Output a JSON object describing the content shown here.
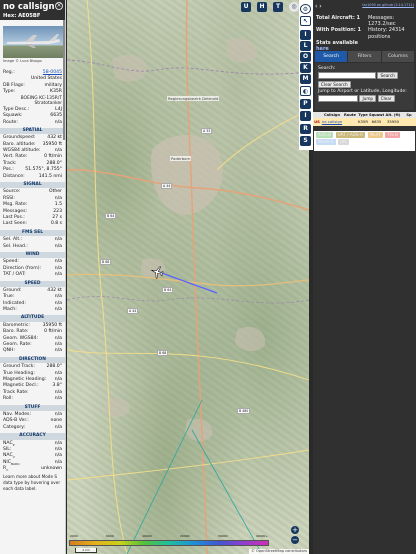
{
  "info": {
    "callsign": "no callsign",
    "hex": "Hex: AE05BF",
    "photo_credit": "Image © Luca Bisogo",
    "reg_label": "Reg.:",
    "reg_value": "58-0045",
    "country": "United States",
    "dbflags_label": "DB Flags:",
    "dbflags_value": "military",
    "type_label": "Type:",
    "type_value": "K35R",
    "type_desc": "BOEING KC-135R/T Stratotanker",
    "typedesc_label": "Type Desc.:",
    "typedesc_value": "L4J",
    "squawk_label": "Squawk:",
    "squawk_value": "6635",
    "route_label": "Route:",
    "route_value": "n/a",
    "sections": {
      "spatial": "SPATIAL",
      "signal": "SIGNAL",
      "fms": "FMS SEL",
      "wind": "WIND",
      "speed": "SPEED",
      "altitude": "ALTITUDE",
      "direction": "DIRECTION",
      "stuff": "STUFF",
      "accuracy": "ACCURACY"
    },
    "spatial": [
      {
        "k": "Groundspeed:",
        "v": "432 kt"
      },
      {
        "k": "Baro. altitude:",
        "v": "35950 ft"
      },
      {
        "k": "WGS84 altitude:",
        "v": "n/a"
      },
      {
        "k": "Vert. Rate:",
        "v": "0 ft/min"
      },
      {
        "k": "Track:",
        "v": "288.0°"
      },
      {
        "k": "Pos.:",
        "v": "51.575°, 8.755°"
      },
      {
        "k": "Distance:",
        "v": "141.5 nmi"
      }
    ],
    "signal": [
      {
        "k": "Source:",
        "v": "Other"
      },
      {
        "k": "RSSI:",
        "v": "n/a"
      },
      {
        "k": "Msg. Rate:",
        "v": "1.5"
      },
      {
        "k": "Messages:",
        "v": "223"
      },
      {
        "k": "Last Pos.:",
        "v": "27 s"
      },
      {
        "k": "Last Seen:",
        "v": "0.8 s"
      }
    ],
    "fms": [
      {
        "k": "Sel. Alt.:",
        "v": "n/a"
      },
      {
        "k": "Sel. Head.:",
        "v": "n/a"
      }
    ],
    "wind": [
      {
        "k": "Speed:",
        "v": "n/a"
      },
      {
        "k": "Direction (from):",
        "v": "n/a"
      },
      {
        "k": "TAT / OAT:",
        "v": "n/a"
      }
    ],
    "speed": [
      {
        "k": "Ground:",
        "v": "432 kt"
      },
      {
        "k": "True:",
        "v": "n/a"
      },
      {
        "k": "Indicated:",
        "v": "n/a"
      },
      {
        "k": "Mach:",
        "v": "n/a"
      }
    ],
    "altitude": [
      {
        "k": "Barometric:",
        "v": "35950 ft"
      },
      {
        "k": "Baro. Rate:",
        "v": "0 ft/min"
      },
      {
        "k": "Geom. WGS84:",
        "v": "n/a"
      },
      {
        "k": "Geom. Rate:",
        "v": "n/a"
      },
      {
        "k": "QNH:",
        "v": "n/a"
      }
    ],
    "direction": [
      {
        "k": "Ground Track:",
        "v": "288.0°"
      },
      {
        "k": "True Heading:",
        "v": "n/a"
      },
      {
        "k": "Magnetic Heading:",
        "v": "n/a"
      },
      {
        "k": "Magnetic Decl.:",
        "v": "3.8°"
      },
      {
        "k": "Track Rate:",
        "v": "n/a"
      },
      {
        "k": "Roll:",
        "v": "n/a"
      }
    ],
    "stuff": [
      {
        "k": "Nav. Modes:",
        "v": "n/a"
      },
      {
        "k": "ADS-B Ver.:",
        "v": "none"
      },
      {
        "k": "Category:",
        "v": "n/a"
      }
    ],
    "accuracy": [
      {
        "k": "NAC",
        "sub": "P",
        "v": "n/a"
      },
      {
        "k": "SIL:",
        "sub": "",
        "v": "n/a"
      },
      {
        "k": "NAC",
        "sub": "V",
        "v": "n/a"
      },
      {
        "k": "NIC",
        "sub": "BARO",
        "v": "n/a"
      },
      {
        "k": "R",
        "sub": "C",
        "v": "unknown"
      }
    ],
    "footer": "Learn more about Mode S data type by hovering over each data label."
  },
  "map": {
    "controls": [
      "U",
      "H",
      "T"
    ],
    "city_main": "Paderborn",
    "city_north": "Regierungsbezirk Detmold",
    "road_labels": [
      "B 64",
      "A 44",
      "B 64",
      "B 68",
      "A 33",
      "B 68",
      "B 480",
      "A 44"
    ],
    "colorbar_ticks": [
      "2000",
      "6000",
      "10000",
      "20000",
      "30000",
      "40000+"
    ],
    "scale": "2 km",
    "attribution": "© OpenStreetMap contributors",
    "zoom_in": "+",
    "zoom_out": "−"
  },
  "right_buttons": [
    "I",
    "L",
    "O",
    "K",
    "M",
    "P",
    "I",
    "R",
    "S"
  ],
  "sidebar": {
    "version": "tar1090 on github (3.14.1711)",
    "total_label": "Total Aircraft: 1",
    "messages_label": "Messages:",
    "messages_value": "1273.2/sec",
    "withpos_label": "With Position: 1",
    "history_label": "History: 24314 positions",
    "stats_label": "Stats available",
    "stats_link": "here",
    "tabs": [
      "Search",
      "Filters",
      "Columns"
    ],
    "search_label": "Search:",
    "search_button": "Search",
    "clear_search": "Clear Search",
    "jump_label": "Jump to Airport or Latitude, Longitude:",
    "jump_button": "Jump",
    "clear_button": "Clear",
    "table_headers": [
      "",
      "Callsign",
      "Route",
      "Type",
      "Squawk",
      "Alt. (ft)",
      "Sp"
    ],
    "table_row": [
      "US",
      "no callsign",
      "",
      "K35R",
      "6635",
      "35950",
      ""
    ],
    "chips": [
      {
        "label": "ADS-B",
        "color": "#b6e0b6"
      },
      {
        "label": "UAT / ADS-R",
        "color": "#cbb97a"
      },
      {
        "label": "MLAT",
        "color": "#f0c88a"
      },
      {
        "label": "TIS-B",
        "color": "#f4a5a5"
      },
      {
        "label": "Mode-S",
        "color": "#c6dcf6"
      },
      {
        "label": "AIS",
        "color": "#d9d9d9"
      }
    ]
  },
  "colors": {
    "header_bg": "#303030",
    "section_bg": "#cfd7df",
    "button_bg": "#17375e",
    "tab_active": "#1f5aa8",
    "row_highlight": "#ffe9b0",
    "track_line": "#5b62ff"
  }
}
